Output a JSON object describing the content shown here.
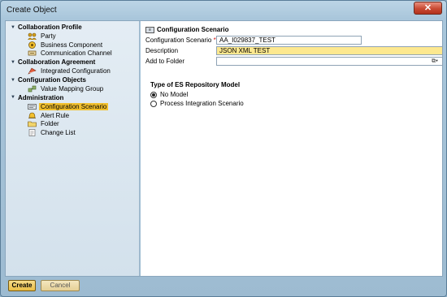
{
  "window": {
    "title": "Create Object",
    "close_label": "✕"
  },
  "tree": {
    "groups": [
      {
        "label": "Collaboration Profile",
        "items": [
          {
            "label": "Party",
            "icon": "party-icon"
          },
          {
            "label": "Business Component",
            "icon": "business-component-icon"
          },
          {
            "label": "Communication Channel",
            "icon": "communication-channel-icon"
          }
        ]
      },
      {
        "label": "Collaboration Agreement",
        "items": [
          {
            "label": "Integrated Configuration",
            "icon": "integrated-configuration-icon"
          }
        ]
      },
      {
        "label": "Configuration Objects",
        "items": [
          {
            "label": "Value Mapping Group",
            "icon": "value-mapping-group-icon"
          }
        ]
      },
      {
        "label": "Administration",
        "items": [
          {
            "label": "Configuration Scenario",
            "icon": "configuration-scenario-icon",
            "selected": true
          },
          {
            "label": "Alert Rule",
            "icon": "alert-rule-icon"
          },
          {
            "label": "Folder",
            "icon": "folder-icon"
          },
          {
            "label": "Change List",
            "icon": "change-list-icon"
          }
        ]
      }
    ]
  },
  "form": {
    "section_title": "Configuration Scenario",
    "fields": {
      "scenario": {
        "label": "Configuration Scenario",
        "required_mark": "*",
        "value": "AA_I029837_TEST"
      },
      "description": {
        "label": "Description",
        "value": "JSON XML TEST"
      },
      "folder": {
        "label": "Add to Folder",
        "value": ""
      }
    },
    "model": {
      "title": "Type of ES Repository Model",
      "options": [
        {
          "label": "No Model",
          "selected": true
        },
        {
          "label": "Process Integration Scenario",
          "selected": false
        }
      ]
    }
  },
  "footer": {
    "create_label": "Create",
    "cancel_label": "Cancel"
  },
  "colors": {
    "selection": "#f2c02e",
    "highlight_field": "#fde88f",
    "close_button": "#c84a33"
  }
}
